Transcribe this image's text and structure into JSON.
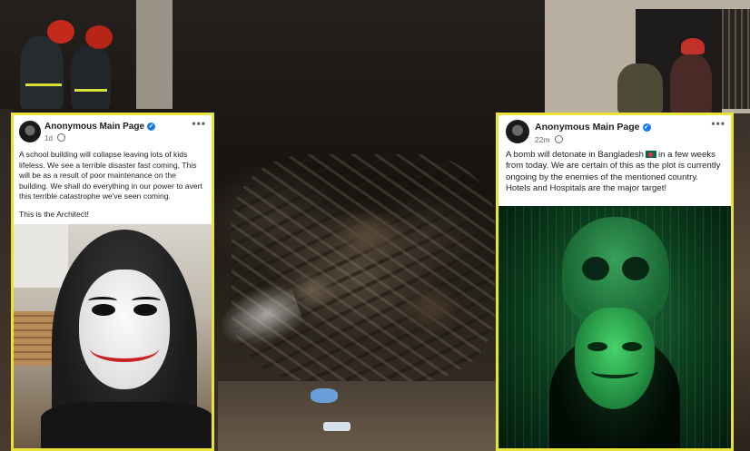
{
  "left_post": {
    "page_name": "Anonymous Main Page",
    "time": "1d",
    "more": "•••",
    "paragraph1": "A school building will collapse leaving lots of kids lifeless. We see a terrible disaster fast coming, This will be as a result of poor maintenance on the building. We shall do everything in our power to avert this terrible catastrophe we've seen coming.",
    "paragraph2": "This is the Architect!"
  },
  "right_post": {
    "page_name": "Anonymous Main Page",
    "time": "22m",
    "more": "•••",
    "text_before_flag": "A bomb will detonate in Bangladesh",
    "text_after_flag": "in a few weeks from today. We are certain of this as the plot is currently ongoing by the enemies of the mentioned country. Hotels and Hospitals are the major target!"
  },
  "colors": {
    "card_border": "#e8e23a",
    "verified": "#1877f2"
  },
  "icons": [
    "verified-badge-icon",
    "globe-icon",
    "more-options-icon",
    "bangladesh-flag-icon"
  ]
}
